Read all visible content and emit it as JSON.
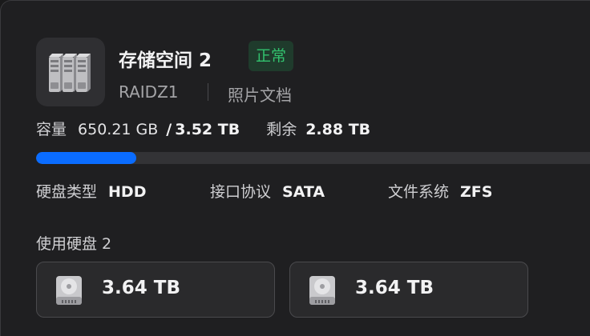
{
  "pool": {
    "name": "存储空间 2",
    "status": "正常",
    "raid_level": "RAIDZ1",
    "type": "照片文档",
    "icon": "server-rack-icon"
  },
  "capacity": {
    "label": "容量",
    "used": "650.21 GB",
    "separator": "/",
    "total": "3.52 TB",
    "remaining_label": "剩余",
    "remaining": "2.88 TB",
    "used_fraction": 0.18
  },
  "specs": {
    "disk_type_label": "硬盘类型",
    "disk_type": "HDD",
    "interface_label": "接口协议",
    "interface": "SATA",
    "filesystem_label": "文件系统",
    "filesystem": "ZFS"
  },
  "disks": {
    "title": "使用硬盘 2",
    "items": [
      {
        "size": "3.64 TB",
        "icon": "hard-disk-icon"
      },
      {
        "size": "3.64 TB",
        "icon": "hard-disk-icon"
      }
    ]
  },
  "colors": {
    "accent": "#0a6cff",
    "status_ok": "#32c26e",
    "background": "#1f1f21"
  }
}
